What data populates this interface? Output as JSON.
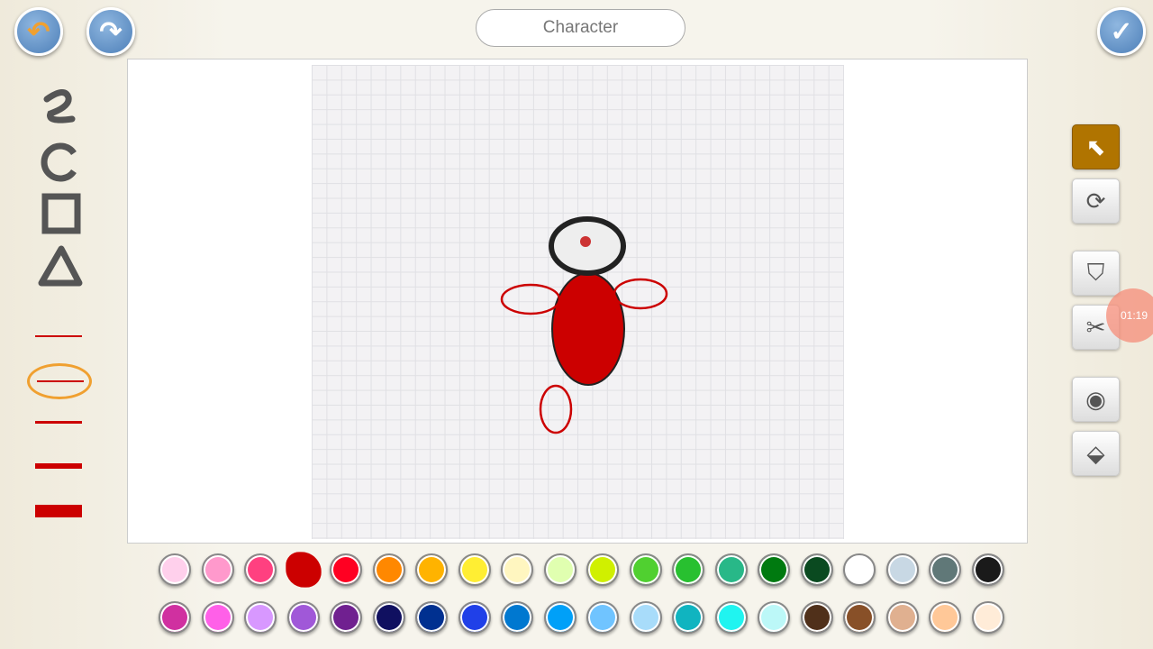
{
  "header": {
    "title": "Character",
    "undo_icon": "undo-icon",
    "redo_icon": "redo-icon",
    "done_icon": "checkmark-icon"
  },
  "left_tools": [
    "freehand-icon",
    "circle-icon",
    "rectangle-icon",
    "triangle-icon"
  ],
  "line_widths": {
    "selected": "ellipse-stroke",
    "items": [
      "thin",
      "ellipse-stroke",
      "medium",
      "thick",
      "extra-thick"
    ]
  },
  "right_tools": [
    {
      "icon": "select-arrow-icon",
      "selected": true
    },
    {
      "icon": "rotate-icon"
    },
    {
      "icon": "stamp-icon"
    },
    {
      "icon": "scissors-icon"
    },
    {
      "icon": "camera-icon"
    },
    {
      "icon": "paint-bucket-icon"
    }
  ],
  "timer": "01:19",
  "palette": {
    "selected": "#cc0000",
    "row1": [
      "#ffd0ec",
      "#ff99cc",
      "#ff4080",
      "#cc0000",
      "#ff0022",
      "#ff8800",
      "#ffb300",
      "#ffee33",
      "#fff6c0",
      "#e0ffb0",
      "#d0f000",
      "#50d030",
      "#28c030",
      "#28b888",
      "#007a10",
      "#0a4a20",
      "#ffffff",
      "#c8d8e4",
      "#607878",
      "#1a1a1a"
    ],
    "row2": [
      "#d030a0",
      "#ff60e8",
      "#d898ff",
      "#a058d8",
      "#702090",
      "#101060",
      "#003090",
      "#2040e8",
      "#0078d0",
      "#00a0f8",
      "#70c4ff",
      "#a8dcfa",
      "#10b4c0",
      "#20f4f0",
      "#bcf8f8",
      "#50301a",
      "#885028",
      "#e0b090",
      "#ffc898",
      "#ffecd8"
    ]
  },
  "colors": {
    "stroke": "#cc0000",
    "select_active": "#b07400",
    "accent": "#4d7fb8"
  }
}
